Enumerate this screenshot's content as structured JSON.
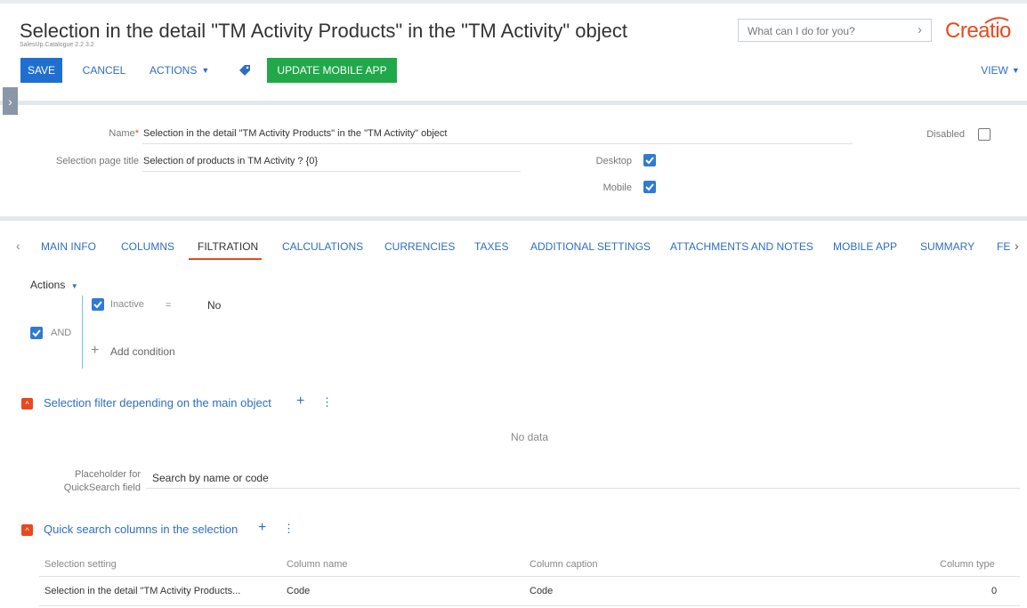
{
  "header": {
    "title": "Selection in the detail \"TM Activity Products\" in the \"TM Activity\" object",
    "subtitle": "SalesUp.Catalogue 2.2.3.2",
    "search_placeholder": "What can I do for you?",
    "logo": "Creatio"
  },
  "toolbar": {
    "save": "SAVE",
    "cancel": "CANCEL",
    "actions": "ACTIONS",
    "update_mobile": "UPDATE MOBILE APP",
    "view": "VIEW"
  },
  "form": {
    "name_label": "Name",
    "name_value": "Selection in the detail \"TM Activity Products\" in the \"TM Activity\" object",
    "page_title_label": "Selection page title",
    "page_title_value": "Selection of products in TM Activity ? {0}",
    "desktop_label": "Desktop",
    "desktop_checked": true,
    "mobile_label": "Mobile",
    "mobile_checked": true,
    "disabled_label": "Disabled",
    "disabled_checked": false
  },
  "tabs": [
    {
      "label": "MAIN INFO"
    },
    {
      "label": "COLUMNS"
    },
    {
      "label": "FILTRATION"
    },
    {
      "label": "CALCULATIONS"
    },
    {
      "label": "CURRENCIES"
    },
    {
      "label": "TAXES"
    },
    {
      "label": "ADDITIONAL SETTINGS"
    },
    {
      "label": "ATTACHMENTS AND NOTES"
    },
    {
      "label": "MOBILE APP"
    },
    {
      "label": "SUMMARY"
    },
    {
      "label": "FEI"
    }
  ],
  "filter": {
    "actions": "Actions",
    "logic": "AND",
    "condition_field": "Inactive",
    "condition_op": "=",
    "condition_value": "No",
    "add_condition": "Add condition"
  },
  "selection_filter": {
    "title": "Selection filter depending on the main object",
    "empty": "No data",
    "placeholder_label_1": "Placeholder for",
    "placeholder_label_2": "QuickSearch field",
    "placeholder_value": "Search by name or code"
  },
  "quick_search": {
    "title": "Quick search columns in the selection",
    "columns": [
      "Selection setting",
      "Column name",
      "Column caption",
      "Column type"
    ],
    "rows": [
      [
        "Selection in the detail \"TM Activity Products...",
        "Code",
        "Code",
        "0"
      ]
    ]
  }
}
